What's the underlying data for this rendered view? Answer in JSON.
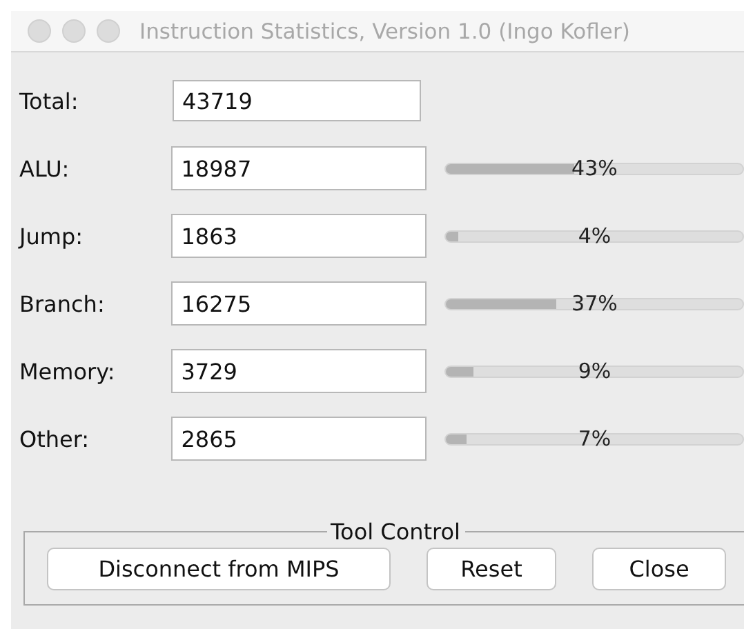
{
  "window": {
    "title": "Instruction Statistics, Version 1.0 (Ingo Kofler)"
  },
  "total": {
    "label": "Total:",
    "value": "43719"
  },
  "categories": [
    {
      "label": "ALU:",
      "value": "18987",
      "level": 0.43,
      "reading": "43%"
    },
    {
      "label": "Jump:",
      "value": "1863",
      "level": 0.04,
      "reading": "4%"
    },
    {
      "label": "Branch:",
      "value": "16275",
      "level": 0.37,
      "reading": "37%"
    },
    {
      "label": "Memory:",
      "value": "3729",
      "level": 0.09,
      "reading": "9%"
    },
    {
      "label": "Other:",
      "value": "2865",
      "level": 0.07,
      "reading": "7%"
    }
  ],
  "tool_control": {
    "title": "Tool Control",
    "buttons": [
      "Disconnect from MIPS",
      "Reset",
      "Close"
    ]
  }
}
